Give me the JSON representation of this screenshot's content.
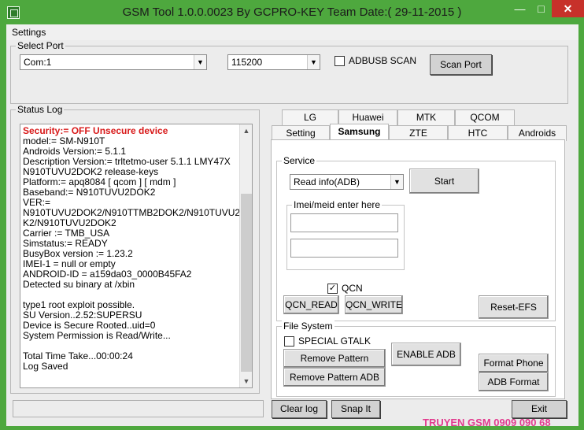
{
  "window": {
    "title": "GSM Tool 1.0.0.0023 By GCPRO-KEY Team  Date:( 29-11-2015 )",
    "minimize_label": "—",
    "maximize_label": "□",
    "close_label": "✕"
  },
  "menu": {
    "settings": "Settings"
  },
  "select_port": {
    "label": "Select Port",
    "port_value": "Com:1",
    "baud_value": "115200",
    "adbusb_label": "ADBUSB SCAN",
    "adbusb_checked": false,
    "scan_button": "Scan Port"
  },
  "status_log": {
    "label": "Status Log",
    "security_line": "Security:= OFF Unsecure device",
    "lines": [
      "model:= SM-N910T",
      "Androids Version:= 5.1.1",
      "Description Version:= trltetmo-user 5.1.1 LMY47X",
      "N910TUVU2DOK2 release-keys",
      "Platform:= apq8084 [ qcom ]  [ mdm ]",
      "Baseband:= N910TUVU2DOK2",
      "VER:=",
      "N910TUVU2DOK2/N910TTMB2DOK2/N910TUVU2DO",
      "K2/N910TUVU2DOK2",
      "Carrier := TMB_USA",
      "Simstatus:= READY",
      "BusyBox version := 1.23.2",
      "IMEI-1 = null or empty",
      "ANDROID-ID = a159da03_0000B45FA2",
      "Detected su binary at /xbin",
      "",
      "type1 root exploit possible.",
      "SU Version..2.52:SUPERSU",
      "Device is Secure Rooted..uid=0",
      "System Permission is Read/Write...",
      "",
      "Total Time Take...00:00:24",
      "Log Saved"
    ]
  },
  "tabs_row1": [
    "LG",
    "Huawei",
    "MTK",
    "QCOM"
  ],
  "tabs_row2": [
    "Setting",
    "Samsung",
    "ZTE",
    "HTC",
    "Androids"
  ],
  "service": {
    "label": "Service",
    "operation_value": "Read info(ADB)",
    "start_button": "Start",
    "imei_label": "Imei/meid enter here",
    "imei1_value": "",
    "imei2_value": "",
    "qcn_label": "QCN",
    "qcn_checked": true,
    "qcn_read": "QCN_READ",
    "qcn_write": "QCN_WRITE",
    "reset_efs": "Reset-EFS"
  },
  "file_system": {
    "label": "File System",
    "special_gtalk": "SPECIAL GTALK",
    "special_gtalk_checked": false,
    "remove_modem": "Remove Pattern MODEM",
    "remove_adb": "Remove Pattern ADB",
    "enable_adb": "ENABLE ADB",
    "format_phone": "Format Phone",
    "adb_format": "ADB Format"
  },
  "footer": {
    "clear_log": "Clear log",
    "snap_it": "Snap It",
    "exit": "Exit",
    "watermark": "TRUYEN GSM 0909 090 68"
  }
}
